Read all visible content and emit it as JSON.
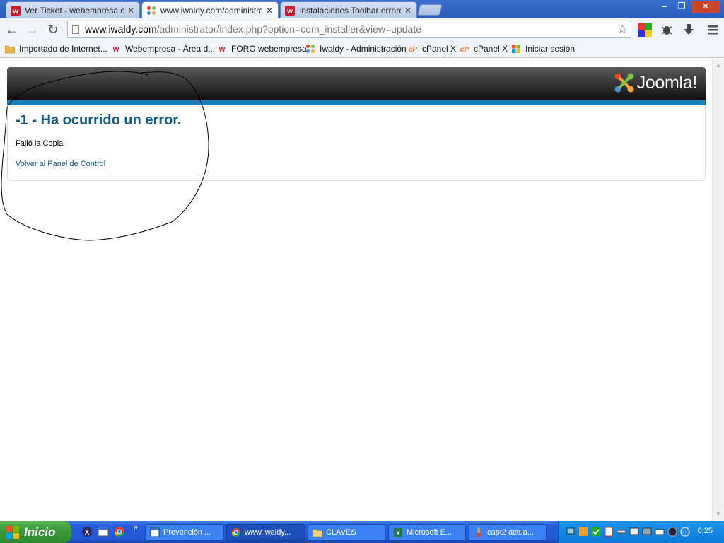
{
  "browser": {
    "tabs": [
      {
        "label": "Ver Ticket - webempresa.com",
        "icon": "webempresa-icon",
        "active": false
      },
      {
        "label": "www.iwaldy.com/administrator",
        "icon": "joomla-icon",
        "active": true
      },
      {
        "label": "Instalaciones Toolbar errores",
        "icon": "webempresa-icon",
        "active": false
      }
    ],
    "tab_close_glyph": "✕",
    "window_controls": {
      "minimize": "–",
      "restore": "❐",
      "close": "✕"
    },
    "url_host": "www.iwaldy.com",
    "url_path": "/administrator/index.php?option=com_installer&view=update"
  },
  "bookmarks": [
    {
      "label": "Importado de Internet...",
      "icon": "folder-icon"
    },
    {
      "label": "Webempresa - Área d...",
      "icon": "webempresa-icon"
    },
    {
      "label": "FORO webempresa",
      "icon": "webempresa-icon"
    },
    {
      "label": "Iwaldy - Administración",
      "icon": "joomla-icon"
    },
    {
      "label": "cPanel X",
      "icon": "cpanel-icon"
    },
    {
      "label": "cPanel X",
      "icon": "cpanel-icon"
    },
    {
      "label": "Iniciar sesión",
      "icon": "windows-flag-icon"
    }
  ],
  "page": {
    "logo_text": "Joomla!",
    "error_title": "-1 - Ha ocurrido un error.",
    "error_message": "Falló la Copia",
    "back_link": "Volver al Panel de Control"
  },
  "taskbar": {
    "start_label": "Inicio",
    "quicklaunch_more": "»",
    "buttons": [
      {
        "label": "Prevención ...",
        "icon": "window-icon",
        "active": false
      },
      {
        "label": "www.iwaldy...",
        "icon": "chrome-icon",
        "active": true
      },
      {
        "label": "CLAVES",
        "icon": "folder-icon",
        "active": false
      },
      {
        "label": "Microsoft E...",
        "icon": "excel-icon",
        "active": false
      },
      {
        "label": "capt2 actua...",
        "icon": "paint-icon",
        "active": false
      }
    ],
    "clock": "0:25"
  },
  "colors": {
    "accent_blue": "#1a80b6",
    "link_blue": "#135a83",
    "taskbar_blue": "#245edb",
    "start_green": "#3a9a3a"
  }
}
